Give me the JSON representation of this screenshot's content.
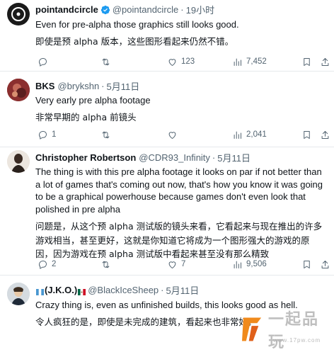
{
  "tweets": [
    {
      "name": "pointandcircle",
      "handle": "@pointandcircle",
      "time": "19小时",
      "text_en": "Even for pre-alpha those graphics still looks good.",
      "text_zh": "即使是预 alpha 版本，这些图形看起来仍然不错。",
      "likes": "123",
      "views": "7,452",
      "replies": "",
      "retweets": ""
    },
    {
      "name": "BKS",
      "handle": "@brykshn",
      "time": "5月11日",
      "text_en": "Very early pre alpha footage",
      "text_zh": "非常早期的 alpha 前镜头",
      "replies": "1",
      "views": "2,041"
    },
    {
      "name": "Christopher Robertson",
      "handle": "@CDR93_Infinity",
      "time": "5月11日",
      "text_en": "The thing is with this pre alpha footage it looks on par if not better than a lot of games that's coming out now, that's how you know it was going to be a graphical powerhouse because games don't even look that polished in pre alpha",
      "text_zh": "问题是，从这个预 alpha 测试版的镜头来看，它看起来与现在推出的许多游戏相当，甚至更好，这就是你知道它将成为一个图形强大的游戏的原因，因为游戏在预 alpha 测试版中看起来甚至没有那么精致",
      "replies": "2",
      "likes": "7",
      "views": "9,506"
    },
    {
      "name": "(J.K.O.)",
      "handle": "@BlackIceSheep",
      "time": "5月11日",
      "text_en": "Crazy thing is, even as unfinished builds, this looks good as hell.",
      "text_zh": "令人疯狂的是，即使是未完成的建筑，看起来也非常好。"
    }
  ],
  "sep": "·",
  "watermark": {
    "text": "一起品玩",
    "url": "www.17pw.com"
  },
  "icons": [
    "avatar",
    "verified-icon",
    "reply-icon",
    "retweet-icon",
    "like-icon",
    "views-icon",
    "bookmark-share-icon"
  ],
  "colors": {
    "verified": "#1d9bf0",
    "muted": "#536471",
    "divider": "#e6e9ec"
  }
}
